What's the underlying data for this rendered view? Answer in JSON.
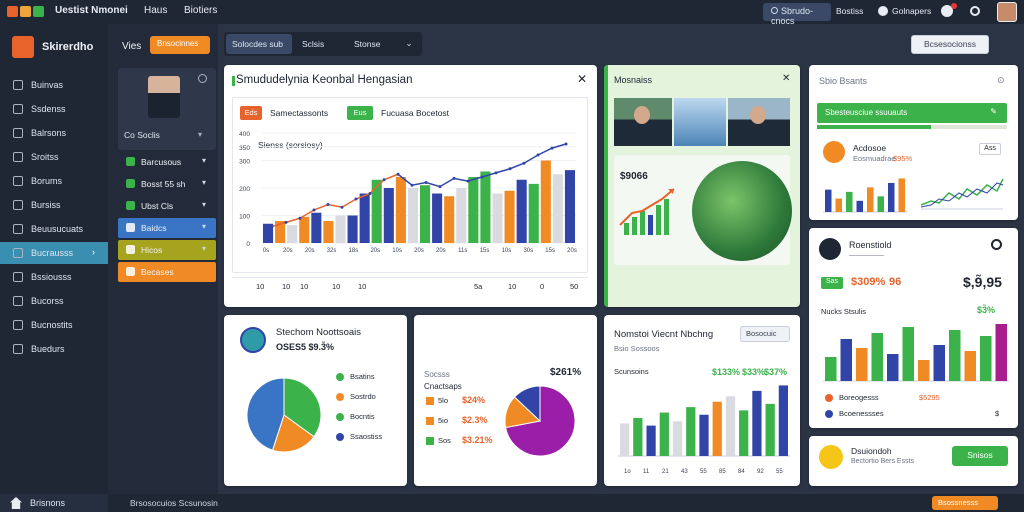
{
  "topbar": {
    "app_title": "Uestist Nmonei",
    "menu_1": "Haus",
    "menu_2": "Biotiers",
    "search_button": "Sbrudo-cnocs",
    "link": "Bostiss",
    "user_label": "Golnapers",
    "colors": {
      "dot1": "#e8632b",
      "dot2": "#f0a53a",
      "dot3": "#3bb24a",
      "dot4": "#2f9a4a"
    }
  },
  "sidebar": {
    "brand": "Skirerdho",
    "items": [
      {
        "label": "Buinvas",
        "icon": "list-icon"
      },
      {
        "label": "Ssdenss",
        "icon": "document-icon"
      },
      {
        "label": "Balrsons",
        "icon": "document-icon"
      },
      {
        "label": "Sroitss",
        "icon": "calendar-icon"
      },
      {
        "label": "Borums",
        "icon": "inbox-icon"
      },
      {
        "label": "Bursiss",
        "icon": "book-icon"
      },
      {
        "label": "Beuusucuats",
        "icon": "location-icon"
      },
      {
        "label": "Bucrausss",
        "icon": "chart-icon",
        "active": true
      },
      {
        "label": "Bssiousss",
        "icon": "grid-icon"
      },
      {
        "label": "Bucorss",
        "icon": "clock-icon"
      },
      {
        "label": "Bucnostits",
        "icon": "briefcase-icon"
      },
      {
        "label": "Buedurs",
        "icon": "users-icon"
      }
    ],
    "footer": "Brisnons"
  },
  "panel2": {
    "title": "Vies",
    "action_button": "Bnsocinnes",
    "profile_name": "Co Soclis",
    "items": [
      {
        "label": "Barcusous",
        "icon": "chart-icon"
      },
      {
        "label": "Bosst 55 sh",
        "icon": "font-icon"
      },
      {
        "label": "Ubst Cls",
        "icon": "document-icon"
      },
      {
        "label": "Baidcs",
        "highlight": "blue"
      },
      {
        "label": "Hicos",
        "highlight": "olive"
      },
      {
        "label": "Becases",
        "highlight": "orange"
      }
    ]
  },
  "tabs": [
    "Solocdes sub",
    "Sclsis",
    "Stonse"
  ],
  "top_right_button": "Bcsesocionss",
  "main_card": {
    "title": "Smududelynia Keonbal Hengasian",
    "pill_1": "Eds",
    "pill_1_text": "Samectassonts",
    "pill_2": "Eus",
    "pill_2_text": "Fucuasa Bocetost",
    "subtitle": "Sienss (sorsiosy)",
    "footer_labels": [
      "10",
      "10",
      "10",
      "10",
      "10",
      "5a",
      "10",
      "0",
      "50"
    ]
  },
  "chart_data": [
    {
      "type": "bar",
      "title": "",
      "ylim": [
        0,
        400
      ],
      "yticks": [
        "0",
        "100",
        "200",
        "300",
        "350",
        "400"
      ],
      "xticks": [
        "0s",
        "20s",
        "20s",
        "32s",
        "18s",
        "20s",
        "10s",
        "20s",
        "20s",
        "11s",
        "15s",
        "10s",
        "30s",
        "15s",
        "20s"
      ],
      "categories": [
        "c1",
        "c2",
        "c3",
        "c4",
        "c5",
        "c6",
        "c7",
        "c8",
        "c9",
        "c10",
        "c11",
        "c12",
        "c13",
        "c14",
        "c15",
        "c16",
        "c17",
        "c18",
        "c19",
        "c20",
        "c21",
        "c22",
        "c23",
        "c24",
        "c25",
        "c26"
      ],
      "values": [
        70,
        80,
        65,
        95,
        110,
        80,
        100,
        100,
        180,
        230,
        200,
        240,
        200,
        210,
        180,
        170,
        200,
        240,
        260,
        180,
        190,
        230,
        215,
        300,
        250,
        265
      ],
      "colors": [
        "#3145a8",
        "#f08a24",
        "#d9dbe0",
        "#f08a24",
        "#3145a8",
        "#f08a24",
        "#d9dbe0",
        "#3145a8",
        "#3145a8",
        "#3bb24a",
        "#3145a8",
        "#f08a24",
        "#d9dbe0",
        "#3bb24a",
        "#3145a8",
        "#f08a24",
        "#d9dbe0",
        "#3bb24a",
        "#3bb24a",
        "#d9dbe0",
        "#f08a24",
        "#3145a8",
        "#3bb24a",
        "#f08a24",
        "#d9dbe0",
        "#3145a8"
      ],
      "line_values": [
        60,
        75,
        90,
        120,
        140,
        130,
        160,
        180,
        230,
        250,
        210,
        220,
        205,
        235,
        225,
        240,
        255,
        270,
        290,
        320,
        345,
        360
      ]
    },
    {
      "type": "pie",
      "values": [
        35,
        20,
        45
      ],
      "colors": [
        "#3bb24a",
        "#f08a24",
        "#3a74c4"
      ]
    },
    {
      "type": "pie",
      "values": [
        72,
        15,
        13
      ],
      "colors": [
        "#9b1ea8",
        "#f08a24",
        "#3145a8"
      ]
    },
    {
      "type": "bar",
      "categories": [
        "1o",
        "11",
        "21",
        "43",
        "55",
        "85",
        "84",
        "92",
        "55"
      ],
      "values": [
        30,
        35,
        28,
        40,
        32,
        45,
        38,
        50,
        55,
        42,
        60,
        48,
        65
      ],
      "colors": [
        "#d9dbe0",
        "#3bb24a",
        "#3145a8",
        "#3bb24a",
        "#d9dbe0",
        "#3bb24a",
        "#3145a8",
        "#f08a24",
        "#d9dbe0",
        "#3bb24a",
        "#3145a8",
        "#3bb24a",
        "#3145a8"
      ]
    },
    {
      "type": "bar",
      "values": [
        40,
        70,
        55,
        80,
        45,
        90,
        35,
        60,
        85,
        50,
        75,
        95
      ],
      "colors": [
        "#3bb24a",
        "#3145a8",
        "#f08a24",
        "#3bb24a",
        "#3145a8",
        "#3bb24a",
        "#f08a24",
        "#3145a8",
        "#3bb24a",
        "#f08a24",
        "#3bb24a",
        "#a81e8c"
      ]
    }
  ],
  "media_card": {
    "title": "Mosnaiss",
    "stat": "$9066"
  },
  "right_top": {
    "title": "Sbio Bsants",
    "bar_text": "Sbesteusciue ssuuauts",
    "name": "Acdosoe",
    "sub": "Eosmuadrae",
    "value": "$95%",
    "badge": "Ass"
  },
  "right_mid": {
    "title": "Roenstiold",
    "sub_pill": "Sas",
    "stat_1": "$309%",
    "stat_2": "96",
    "big_value": "$,9̃,95",
    "percent": "$3̃%",
    "caption": "Nucks Stsulis",
    "legend_1": "Boreogesss",
    "legend_2": "$5295",
    "legend_3": "Bcoenessses",
    "legend_4": "$"
  },
  "right_bottom": {
    "name": "Dsuiondoh",
    "sub": "Bectortio Bers Essts",
    "button": "Snisos"
  },
  "bottom_left_card": {
    "name": "Stechom Noottsoais",
    "value": "OSES5 $9.3̃%",
    "legend": [
      {
        "label": "Bsatins",
        "color": "#3bb24a"
      },
      {
        "label": "Sostrdo",
        "color": "#f08a24"
      },
      {
        "label": "Bocntis",
        "color": "#3bb24a"
      },
      {
        "label": "Ssaostiss",
        "color": "#3145a8"
      }
    ]
  },
  "bottom_mid_card": {
    "header_1": "Socsss",
    "header_2": "Cnactsaps",
    "top_value": "$261%",
    "rows": [
      {
        "label": "5lo",
        "value": "$24%",
        "color": "#f08a24"
      },
      {
        "label": "5io",
        "value": "$2.3%",
        "color": "#f08a24"
      },
      {
        "label": "Sos",
        "value": "$3.21%",
        "color": "#3bb24a"
      }
    ]
  },
  "bottom_right_card": {
    "title": "Nomstoi Viecnt Nbchng",
    "button": "Bosocuic",
    "sub": "Bsio Sossoos",
    "label_1": "Scunsoins",
    "stat_1": "$133%",
    "stat_2": "$33%",
    "stat_3": "$37%"
  },
  "bottombar": {
    "text": "Brsosocuios Scsunosin",
    "button": "Bsossnesss"
  }
}
